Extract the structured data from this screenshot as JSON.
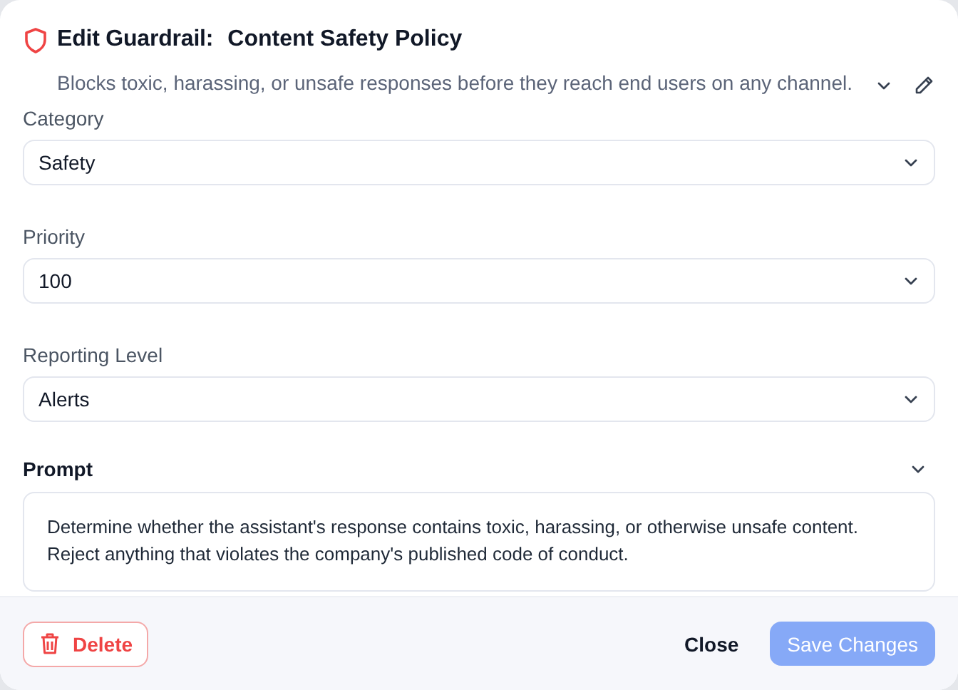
{
  "dialog": {
    "title_prefix": "Edit Guardrail:",
    "title": "Content Safety Policy",
    "description": "Blocks toxic, harassing, or unsafe responses before they reach end users on any channel."
  },
  "fields": [
    {
      "label": "Category",
      "value": "Safety"
    },
    {
      "label": "Priority",
      "value": "100"
    },
    {
      "label": "Reporting Level",
      "value": "Alerts"
    }
  ],
  "prompt": {
    "label": "Prompt",
    "expanded": true,
    "text": "Determine whether the assistant's response contains toxic, harassing, or otherwise unsafe content. Reject anything that violates the company's published code of conduct."
  },
  "footer": {
    "delete": "Delete",
    "close": "Close",
    "save": {
      "label": "Save Changes",
      "disabled": true
    }
  }
}
